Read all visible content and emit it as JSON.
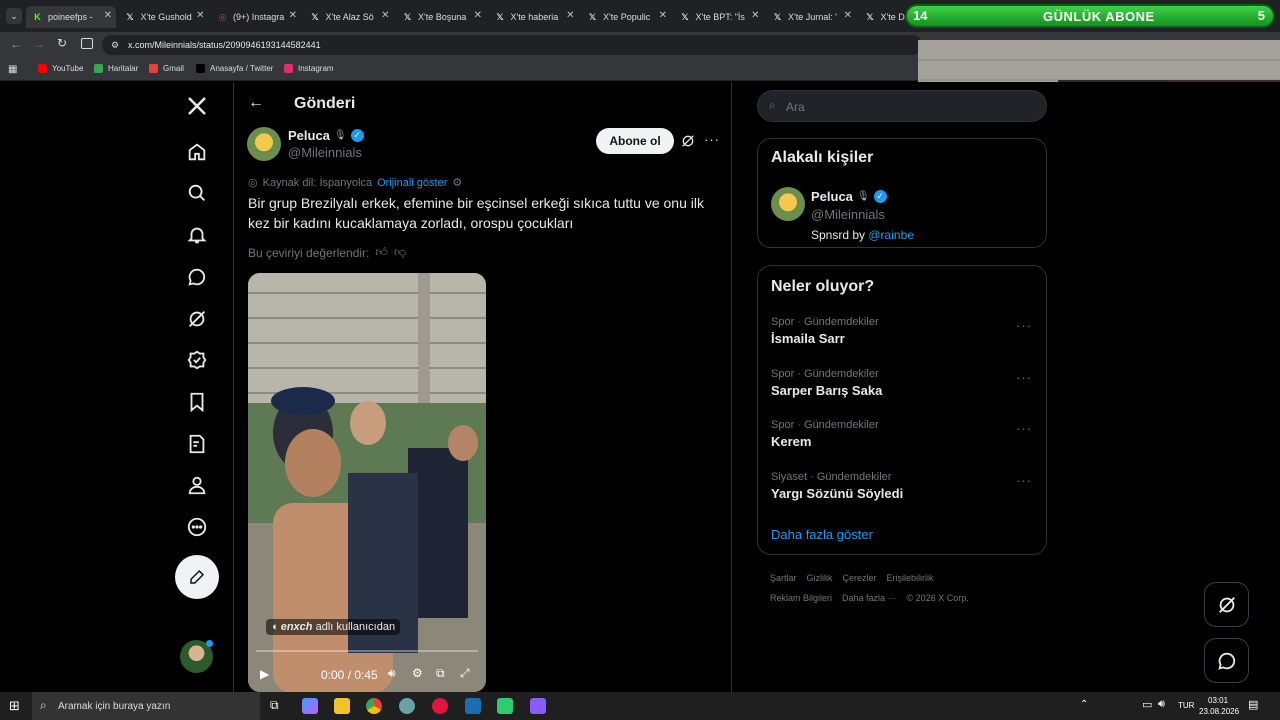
{
  "tabs": [
    {
      "label": "poineefps -",
      "icon": "kick-icon",
      "color": "#53fc18"
    },
    {
      "label": "X'te Gushold",
      "icon": "x-icon",
      "color": "#ffffff"
    },
    {
      "label": "(9+) Instagra",
      "icon": "instagram-icon",
      "color": "#e1306c"
    },
    {
      "label": "X'te Alaz Sö",
      "icon": "x-icon",
      "color": "#ffffff"
    },
    {
      "label": "X'te Boşuna",
      "icon": "x-icon",
      "color": "#ffffff"
    },
    {
      "label": "X'te haberia",
      "icon": "x-icon",
      "color": "#ffffff"
    },
    {
      "label": "X'te Populic",
      "icon": "x-icon",
      "color": "#ffffff"
    },
    {
      "label": "X'te BPT: \"İs",
      "icon": "x-icon",
      "color": "#ffffff"
    },
    {
      "label": "X'te Jurnal: '",
      "icon": "x-icon",
      "color": "#ffffff"
    },
    {
      "label": "X'te Dai",
      "icon": "x-icon",
      "color": "#ffffff"
    }
  ],
  "address": "x.com/Mileinnials/status/2090946193144582441",
  "bookmarks": [
    {
      "label": "YouTube",
      "color": "#ff0000"
    },
    {
      "label": "Haritalar",
      "color": "#34a853"
    },
    {
      "label": "Gmail",
      "color": "#ea4335"
    },
    {
      "label": "Anasayfa / Twitter",
      "color": "#000000"
    },
    {
      "label": "Instagram",
      "color": "#e1306c"
    }
  ],
  "overlay": {
    "left": "14",
    "title": "GÜNLÜK ABONE",
    "right": "5"
  },
  "header": {
    "title": "Gönderi"
  },
  "post": {
    "name": "Peluca",
    "handle": "@Mileinnials",
    "subscribe": "Abone ol",
    "source_lang": "Kaynak dil: İspanyolca",
    "show_original": "Orijinali göster",
    "text": "Bir grup Brezilyalı erkek, efemine bir eşcinsel erkeği sıkıca tuttu ve onu ilk kez bir kadını kucaklamaya zorladı, orospu çocukları",
    "rate": "Bu çeviriyi değerlendir:",
    "video": {
      "credit_user": "enxch",
      "credit_suffix": "adlı kullanıcıdan",
      "time": "0:00 / 0:45"
    }
  },
  "search": {
    "placeholder": "Ara"
  },
  "related": {
    "title": "Alakalı kişiler",
    "name": "Peluca",
    "handle": "@Mileinnials",
    "bio_prefix": "Spnsrd by",
    "bio_link": "@rainbe"
  },
  "trends": {
    "title": "Neler oluyor?",
    "items": [
      {
        "category": "Spor · Gündemdekiler",
        "name": "İsmaila Sarr"
      },
      {
        "category": "Spor · Gündemdekiler",
        "name": "Sarper Barış Saka"
      },
      {
        "category": "Spor · Gündemdekiler",
        "name": "Kerem"
      },
      {
        "category": "Siyaset · Gündemdekiler",
        "name": "Yargı Sözünü Söyledi"
      }
    ],
    "more": "Daha fazla göster"
  },
  "footer": {
    "row1": [
      "Şartlar",
      "Gizlilik",
      "Çerezler",
      "Erişilebilirlik"
    ],
    "row2": [
      "Reklam Bilgileri",
      "Daha fazla ···",
      "© 2026 X Corp."
    ]
  },
  "taskbar": {
    "search": "Aramak için buraya yazın",
    "lang": "TUR",
    "time": "03:01",
    "date": "23.08.2026"
  }
}
